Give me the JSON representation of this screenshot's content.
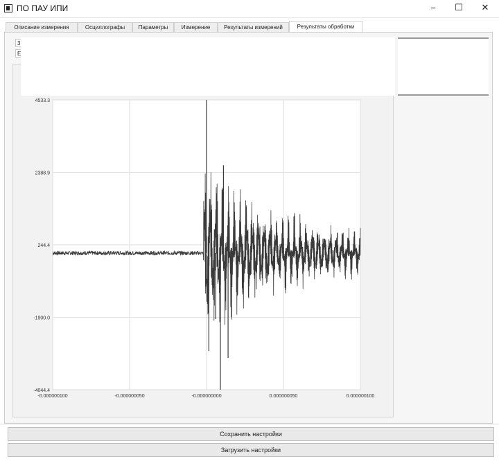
{
  "window": {
    "title": "ПО ПАУ ИПИ",
    "minimize_glyph": "−",
    "maximize_glyph": "☐",
    "close_glyph": "✕"
  },
  "tabs": [
    {
      "label": "Описание измерения"
    },
    {
      "label": "Осциллографы"
    },
    {
      "label": "Параметры"
    },
    {
      "label": "Измерение"
    },
    {
      "label": "Результаты измерений"
    },
    {
      "label": "Результаты обработки"
    }
  ],
  "active_tab_index": 5,
  "side_controls": {
    "box1_text": "3",
    "box2_text": "E"
  },
  "chart_data": {
    "type": "line",
    "y_ticks": [
      "4533.3",
      "2388.9",
      "244.4",
      "-1900.0",
      "-4044.4"
    ],
    "x_ticks": [
      "-0.000000100",
      "-0.000000050",
      "-0.000000000",
      "0.000000050",
      "0.000000100"
    ],
    "xlim": [
      -1e-07,
      1e-07
    ],
    "ylim": [
      -4044.4,
      4533.3
    ],
    "grid": true,
    "line_color": "#3a3a3a",
    "baseline": 0,
    "trigger_x": 0,
    "noise_before_trigger": 60,
    "spike_peak_high": 4533.3,
    "spike_peak_low": -4044.4
  },
  "buttons": {
    "save_settings": "Сохранить настройки",
    "load_settings": "Загрузить настройки"
  }
}
